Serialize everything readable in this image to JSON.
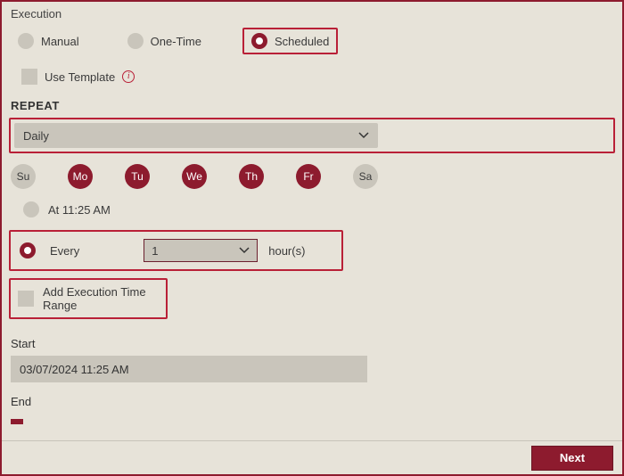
{
  "execution": {
    "sectionLabel": "Execution",
    "options": {
      "manual": "Manual",
      "oneTime": "One-Time",
      "scheduled": "Scheduled"
    },
    "useTemplate": "Use Template"
  },
  "repeat": {
    "title": "REPEAT",
    "frequency": "Daily",
    "days": {
      "su": "Su",
      "mo": "Mo",
      "tu": "Tu",
      "we": "We",
      "th": "Th",
      "fr": "Fr",
      "sa": "Sa"
    },
    "atTime": "At 11:25 AM",
    "everyLabel": "Every",
    "everyValue": "1",
    "everyUnit": "hour(s)",
    "addRange": "Add Execution Time Range"
  },
  "start": {
    "label": "Start",
    "value": "03/07/2024 11:25 AM"
  },
  "end": {
    "label": "End"
  },
  "footer": {
    "next": "Next"
  }
}
